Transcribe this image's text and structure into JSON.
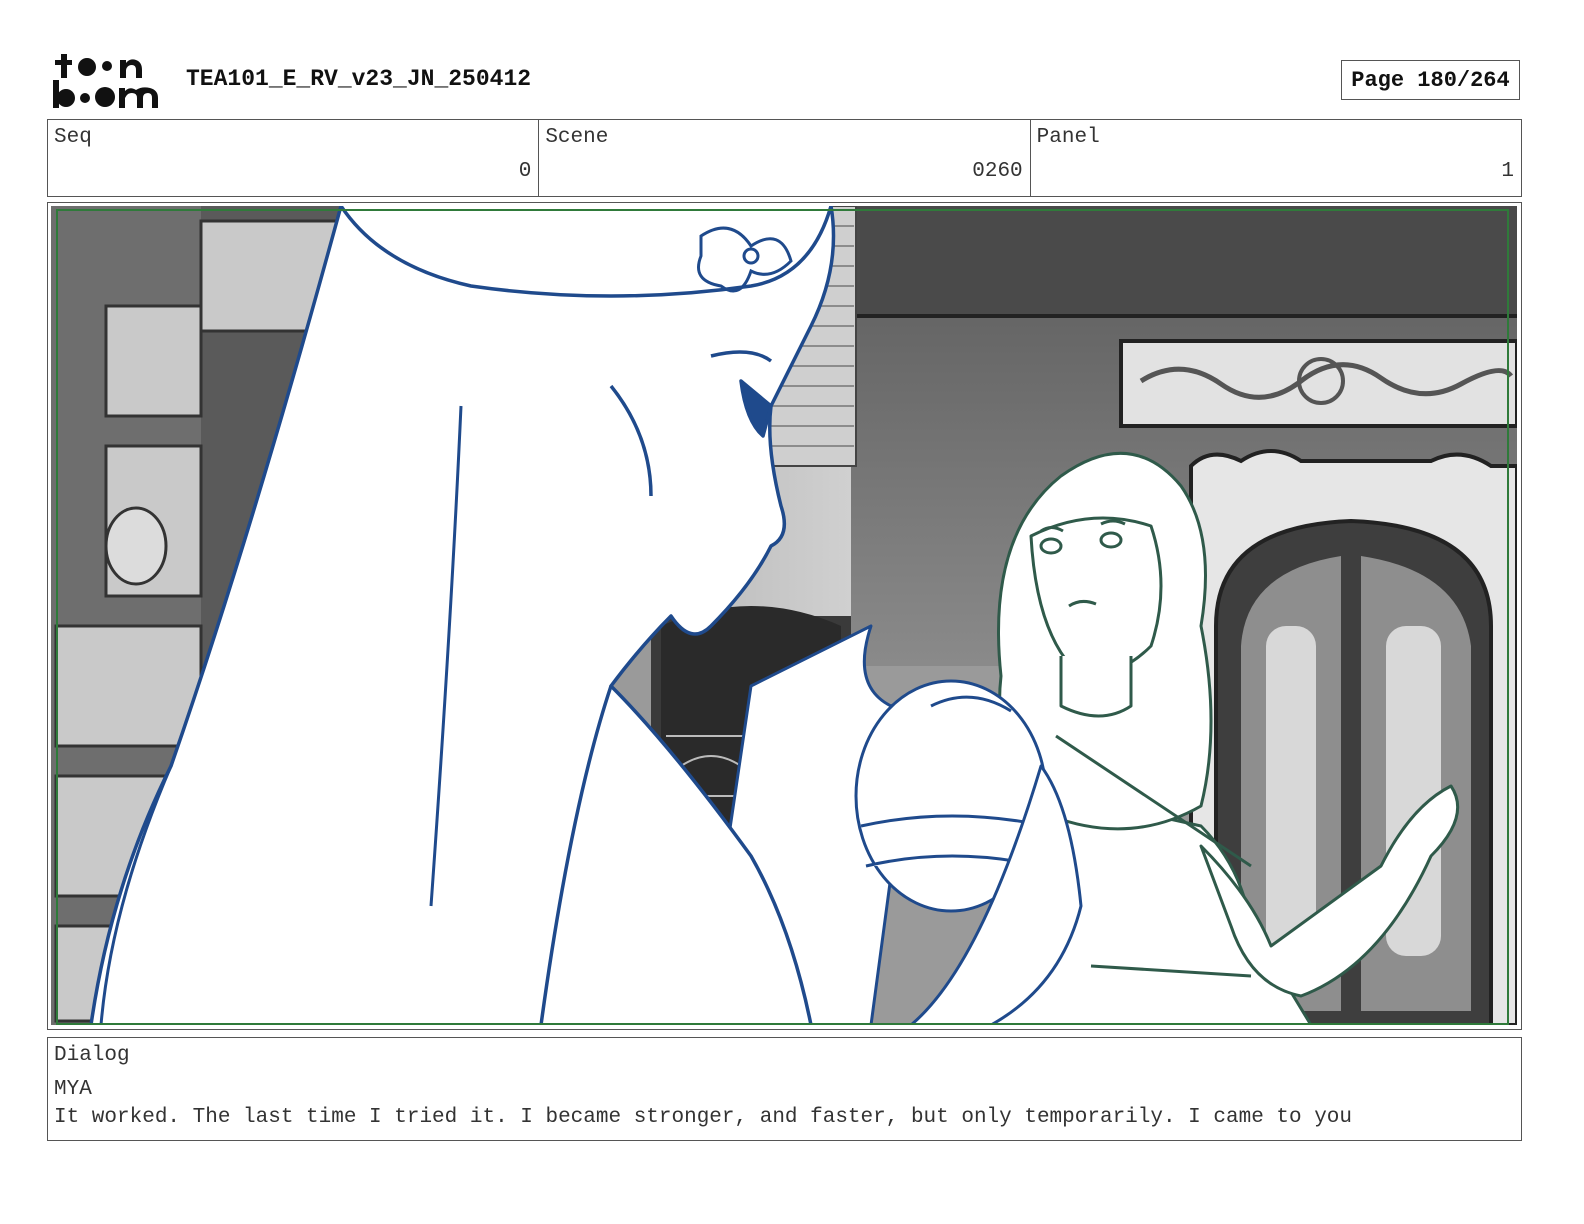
{
  "header": {
    "logo_top": "toon",
    "logo_bottom": "boom",
    "project_title": "TEA101_E_RV_v23_JN_250412",
    "page_label": "Page 180/264"
  },
  "info": {
    "seq_label": "Seq",
    "seq_value": "0",
    "scene_label": "Scene",
    "scene_value": "0260",
    "panel_label": "Panel",
    "panel_value": "1"
  },
  "dialog": {
    "label": "Dialog",
    "speaker": "MYA",
    "line": "It worked. The last time I tried it. I became stronger, and faster, but only temporarily. I came to you"
  },
  "colors": {
    "line_blue": "#1f4a8c",
    "line_green": "#2f5a4a",
    "frame_green": "#2f7a3a"
  }
}
